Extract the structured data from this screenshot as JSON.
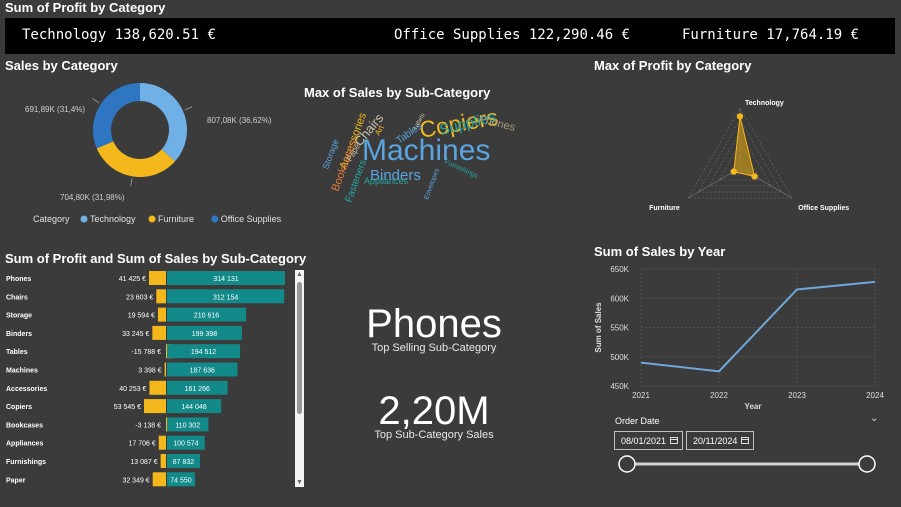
{
  "kpi": {
    "title": "Sum of Profit by Category",
    "items": [
      {
        "label": "Technology",
        "value": "138,620.51 €"
      },
      {
        "label": "Office Supplies",
        "value": "122,290.46 €"
      },
      {
        "label": "Furniture",
        "value": "17,764.19 €"
      }
    ]
  },
  "cards": {
    "top_subcategory": {
      "value": "Phones",
      "label": "Top Selling Sub-Category"
    },
    "top_sales": {
      "value": "2,20M",
      "label": "Top Sub-Category Sales"
    }
  },
  "slicer": {
    "label": "Order Date",
    "start": "08/01/2021",
    "end": "20/11/2024",
    "range": [
      0,
      1
    ]
  },
  "colors": {
    "technology": "#6fb0e6",
    "furniture": "#f5b81c",
    "office_supplies": "#2f76c2",
    "sales_bar": "#138a8a",
    "profit_bar": "#f5b81c",
    "radar": "#b58a1e"
  },
  "chart_data": [
    {
      "id": "donut",
      "type": "pie",
      "title": "Sales by Category",
      "legend_title": "Category",
      "legend_position": "bottom",
      "slices": [
        {
          "name": "Technology",
          "value": 807.08,
          "label": "807,08K (36,62%)",
          "color": "#6fb0e6"
        },
        {
          "name": "Furniture",
          "value": 704.8,
          "label": "704,80K (31,98%)",
          "color": "#f5b81c"
        },
        {
          "name": "Office Supplies",
          "value": 691.89,
          "label": "691,89K (31,4%)",
          "color": "#2f76c2"
        }
      ]
    },
    {
      "id": "wordcloud",
      "type": "wordcloud",
      "title": "Max of Sales by Sub-Category",
      "words": [
        {
          "text": "Machines",
          "color": "#5aa4e0"
        },
        {
          "text": "Copiers",
          "color": "#f5b81c"
        },
        {
          "text": "Binders",
          "color": "#5aa4e0"
        },
        {
          "text": "Supplies",
          "color": "#26a6a0"
        },
        {
          "text": "Phones",
          "color": "#a89a7c"
        },
        {
          "text": "Chairs",
          "color": "#c9c2a8"
        },
        {
          "text": "Accessories",
          "color": "#f5b81c"
        },
        {
          "text": "Bookcases",
          "color": "#e07a3a"
        },
        {
          "text": "Appliances",
          "color": "#26a6a0"
        },
        {
          "text": "Fasteners",
          "color": "#26a6a0"
        },
        {
          "text": "Storage",
          "color": "#5aa4e0"
        },
        {
          "text": "Tables",
          "color": "#5aa4e0"
        },
        {
          "text": "Paper",
          "color": "#c9c2a8"
        },
        {
          "text": "Art",
          "color": "#f5b81c"
        },
        {
          "text": "Labels",
          "color": "#c9c2a8"
        },
        {
          "text": "Envelopes",
          "color": "#5aa4e0"
        },
        {
          "text": "Furnishings",
          "color": "#26a6a0"
        }
      ]
    },
    {
      "id": "radar",
      "type": "radar",
      "title": "Max of Profit by Category",
      "axes": [
        "Technology",
        "Office Supplies",
        "Furniture"
      ],
      "values": [
        0.86,
        0.28,
        0.12
      ]
    },
    {
      "id": "bars",
      "type": "bar",
      "title": "Sum of Profit and Sum of Sales by Sub-Category",
      "categories": [
        "Phones",
        "Chairs",
        "Storage",
        "Binders",
        "Tables",
        "Machines",
        "Accessories",
        "Copiers",
        "Bookcases",
        "Appliances",
        "Furnishings",
        "Paper"
      ],
      "series": [
        {
          "name": "Sum of Profit",
          "values": [
            41425,
            23603,
            19594,
            33245,
            -15788,
            3398,
            40253,
            53545,
            -3138,
            17706,
            13087,
            32349
          ],
          "labels": [
            "41 425 €",
            "23 603 €",
            "19 594 €",
            "33 245 €",
            "-15 788 €",
            "3 398 €",
            "40 253 €",
            "53 545 €",
            "-3 138 €",
            "17 706 €",
            "13 087 €",
            "32 349 €"
          ]
        },
        {
          "name": "Sum of Sales",
          "values": [
            314131,
            312154,
            210616,
            199398,
            194512,
            187636,
            161266,
            144048,
            110302,
            100574,
            87832,
            74550
          ],
          "labels": [
            "314 131",
            "312 154",
            "210 616",
            "199 398",
            "194 512",
            "187 636",
            "161 266",
            "144 048",
            "110 302",
            "100 574",
            "87 832",
            "74 550"
          ]
        }
      ]
    },
    {
      "id": "line",
      "type": "line",
      "title": "Sum of Sales by Year",
      "xlabel": "Year",
      "ylabel": "Sum of Sales",
      "x": [
        2021,
        2022,
        2023,
        2024
      ],
      "y": [
        490000,
        475000,
        615000,
        628000
      ],
      "ylim": [
        450000,
        650000
      ],
      "yticks": [
        450000,
        500000,
        550000,
        600000,
        650000
      ],
      "ytick_labels": [
        "450K",
        "500K",
        "550K",
        "600K",
        "650K"
      ],
      "grid": true
    }
  ]
}
